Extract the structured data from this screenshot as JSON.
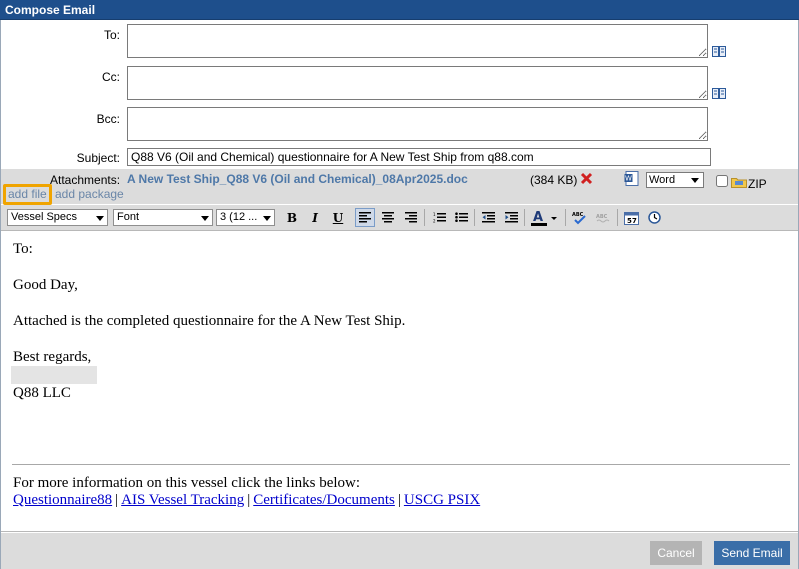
{
  "window": {
    "title": "Compose Email"
  },
  "fields": {
    "to_label": "To:",
    "cc_label": "Cc:",
    "bcc_label": "Bcc:",
    "subject_label": "Subject:",
    "subject_value": "Q88 V6 (Oil and Chemical) questionnaire for A New Test Ship from q88.com"
  },
  "attachments": {
    "label": "Attachments:",
    "file_name": "Q88 V6 (Oil and Chemical)_08Apr2025.doc",
    "file_name_prefix": "A New Test Ship_",
    "file_size": "(384 KB)",
    "format_selected": "Word",
    "zip_label": "ZIP",
    "add_file": "add file",
    "add_package": "add package"
  },
  "toolbar": {
    "style_select": "Vessel Specs",
    "font_select": "Font",
    "size_select": "3 (12 ...",
    "bold": "B",
    "italic": "I",
    "underline": "U"
  },
  "body": {
    "line_to": "To:",
    "greeting": "Good Day,",
    "message": "Attached is the completed questionnaire for the A New Test Ship.",
    "closing": "Best regards,",
    "company": "Q88 LLC",
    "more_info": "For more information on this vessel click the links below:",
    "links": [
      "Questionnaire88",
      "AIS Vessel Tracking",
      "Certificates/Documents",
      "USCG PSIX"
    ]
  },
  "buttons": {
    "cancel": "Cancel",
    "send": "Send Email"
  },
  "colors": {
    "title_bar": "#1e4f8c",
    "send_button": "#3a6ea8",
    "highlight": "#f0a400"
  }
}
